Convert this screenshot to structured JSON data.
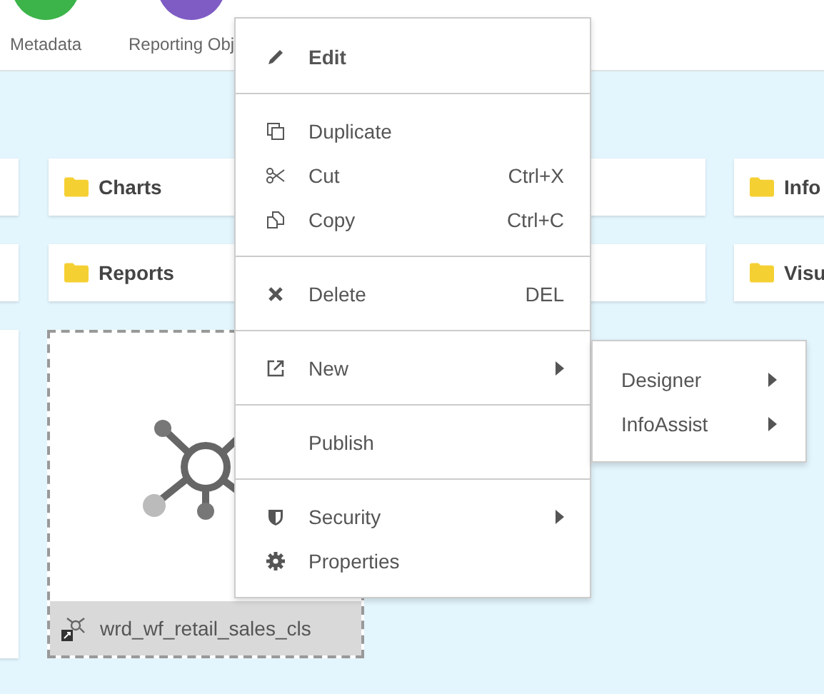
{
  "top_bar": {
    "items": [
      {
        "label": "Metadata",
        "color": "#3cb44a"
      },
      {
        "label": "Reporting Obj",
        "color": "#7e5cc4"
      }
    ]
  },
  "folders": [
    {
      "cards": [
        "Charts",
        "Info"
      ]
    },
    {
      "cards": [
        "Reports",
        "Visu"
      ]
    }
  ],
  "tile": {
    "name": "wrd_wf_retail_sales_cls",
    "selected": true
  },
  "context_menu": {
    "sections": [
      [
        {
          "label": "Edit",
          "default": true,
          "has_submenu": false
        }
      ],
      [
        {
          "label": "Duplicate",
          "default": false,
          "has_submenu": false
        },
        {
          "label": "Cut",
          "shortcut": "Ctrl+X",
          "default": false,
          "has_submenu": false
        },
        {
          "label": "Copy",
          "shortcut": "Ctrl+C",
          "default": false,
          "has_submenu": false
        }
      ],
      [
        {
          "label": "Delete",
          "shortcut": "DEL",
          "default": false,
          "has_submenu": false
        }
      ],
      [
        {
          "label": "New",
          "default": false,
          "has_submenu": true
        }
      ],
      [
        {
          "label": "Publish",
          "default": false,
          "has_submenu": false
        }
      ],
      [
        {
          "label": "Security",
          "default": false,
          "has_submenu": true
        },
        {
          "label": "Properties",
          "default": false,
          "has_submenu": false
        }
      ]
    ]
  },
  "submenu": {
    "items": [
      {
        "label": "Designer",
        "has_submenu": true
      },
      {
        "label": "InfoAssist",
        "has_submenu": true
      }
    ]
  }
}
